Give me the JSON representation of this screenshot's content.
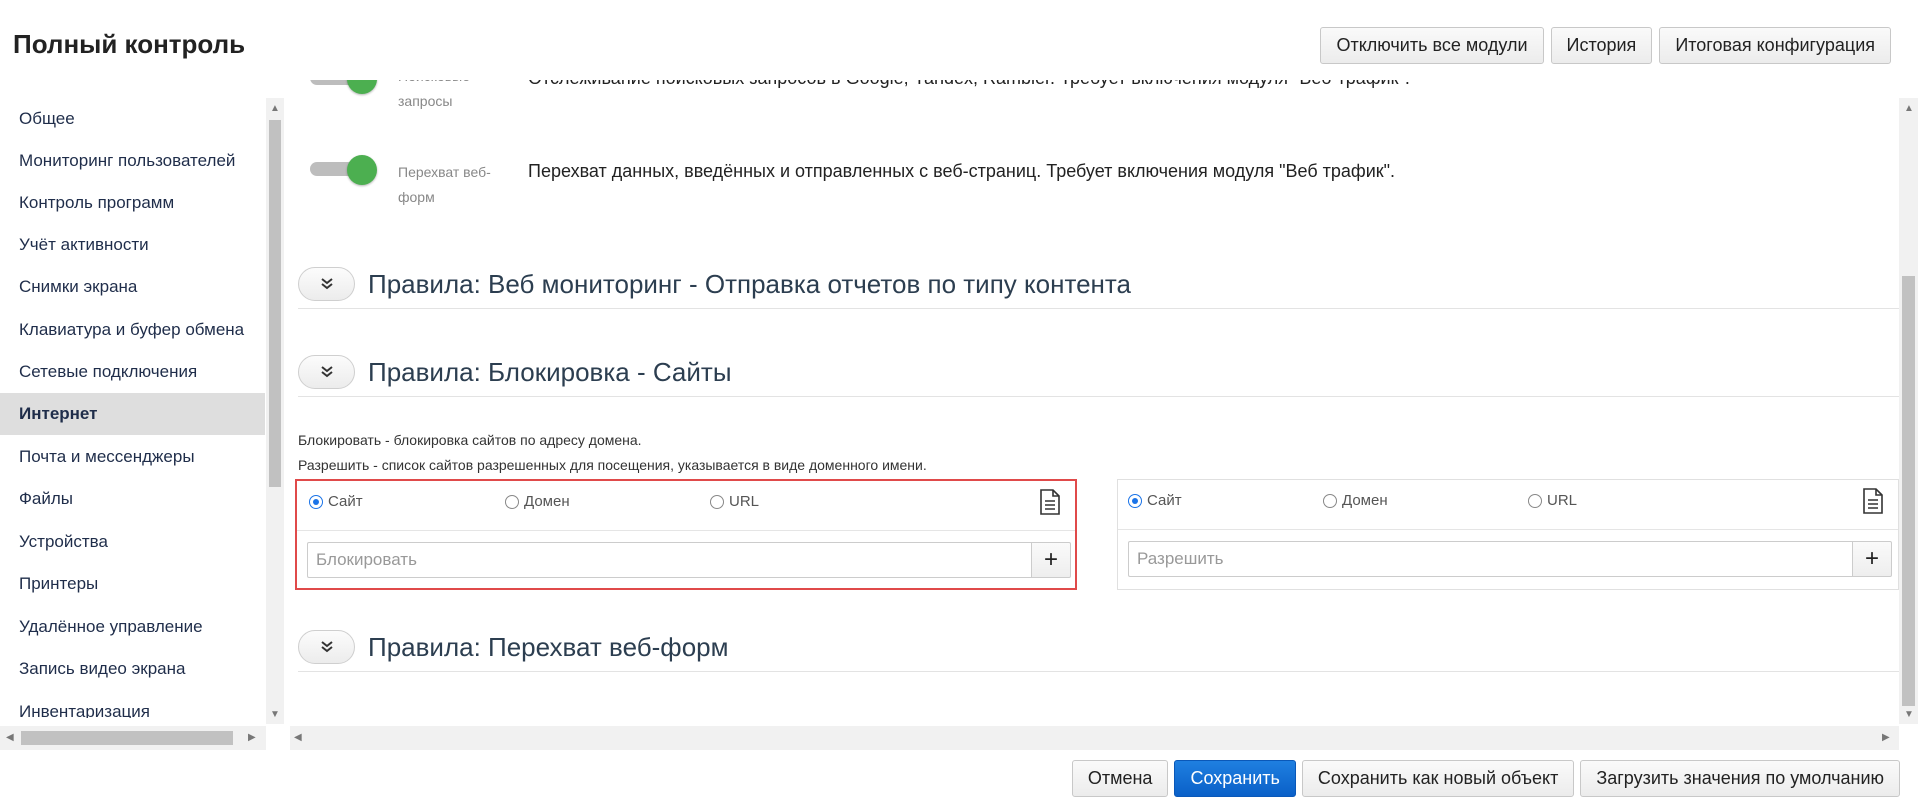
{
  "header": {
    "title": "Полный контроль",
    "buttons": [
      "Отключить все модули",
      "История",
      "Итоговая конфигурация"
    ]
  },
  "sidebar": {
    "items": [
      {
        "label": "Общее"
      },
      {
        "label": "Мониторинг пользователей"
      },
      {
        "label": "Контроль программ"
      },
      {
        "label": "Учёт активности"
      },
      {
        "label": "Снимки экрана"
      },
      {
        "label": "Клавиатура и буфер обмена"
      },
      {
        "label": "Сетевые подключения"
      },
      {
        "label": "Интернет",
        "active": true
      },
      {
        "label": "Почта и мессенджеры"
      },
      {
        "label": "Файлы"
      },
      {
        "label": "Устройства"
      },
      {
        "label": "Принтеры"
      },
      {
        "label": "Удалённое управление"
      },
      {
        "label": "Запись видео экрана"
      },
      {
        "label": "Инвентаризация"
      }
    ]
  },
  "toggles": [
    {
      "label": "Поисковые запросы",
      "description": "Отслеживание поисковых запросов в Google, Yandex, Rambler. Требует включения модуля \"Веб-трафик\".",
      "enabled": true
    },
    {
      "label": "Перехват веб-форм",
      "description": "Перехват данных, введённых и отправленных с веб-страниц. Требует включения модуля \"Веб трафик\".",
      "enabled": true
    }
  ],
  "sections": {
    "web_monitoring": "Правила: Веб мониторинг - Отправка отчетов по типу контента",
    "blocking": "Правила: Блокировка - Сайты",
    "web_forms": "Правила: Перехват веб-форм"
  },
  "blocking_info": {
    "line1": "Блокировать - блокировка сайтов по адресу домена.",
    "line2": "Разрешить - список сайтов разрешенных для посещения, указывается в виде доменного имени."
  },
  "block_panel": {
    "options": [
      "Сайт",
      "Домен",
      "URL"
    ],
    "selected": "Сайт",
    "placeholder": "Блокировать",
    "value": ""
  },
  "allow_panel": {
    "options": [
      "Сайт",
      "Домен",
      "URL"
    ],
    "selected": "Сайт",
    "placeholder": "Разрешить",
    "value": ""
  },
  "add_symbol": "+",
  "footer": {
    "cancel": "Отмена",
    "save": "Сохранить",
    "save_new": "Сохранить как новый объект",
    "load_defaults": "Загрузить значения по умолчанию"
  },
  "colors": {
    "accent": "#1a73e8",
    "toggle_on": "#4caf50",
    "highlight_border": "#e04a4a",
    "primary_button": "#0a60c8"
  }
}
